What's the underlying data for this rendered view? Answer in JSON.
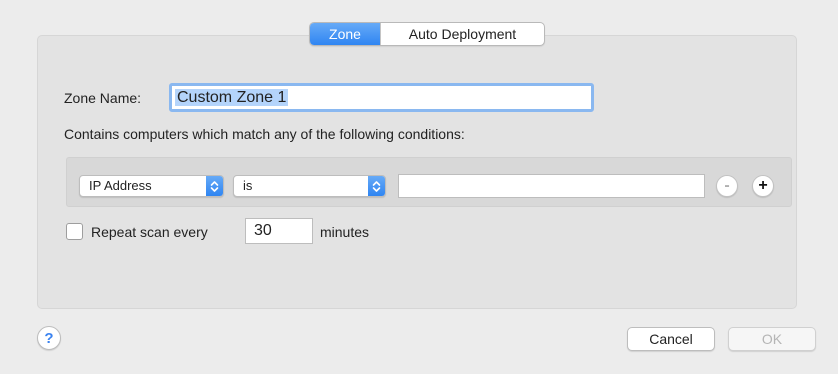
{
  "tabs": [
    {
      "label": "Zone",
      "active": true
    },
    {
      "label": "Auto Deployment",
      "active": false
    }
  ],
  "zone_name": {
    "label": "Zone Name:",
    "value": "Custom Zone 1"
  },
  "conditions": {
    "description": "Contains computers which match any of the following conditions:",
    "rows": [
      {
        "field": "IP Address",
        "operator": "is",
        "value": ""
      }
    ],
    "remove_label": "-",
    "add_label": "+"
  },
  "repeat_scan": {
    "checked": false,
    "label": "Repeat scan every",
    "minutes": "30",
    "unit_label": "minutes"
  },
  "footer": {
    "help_label": "?",
    "cancel_label": "Cancel",
    "ok_label": "OK"
  },
  "colors": {
    "accent": "#3b83f0",
    "window_bg": "#ececec",
    "groupbox_bg": "#e3e3e3",
    "focus_ring": "#8ab8f0"
  }
}
